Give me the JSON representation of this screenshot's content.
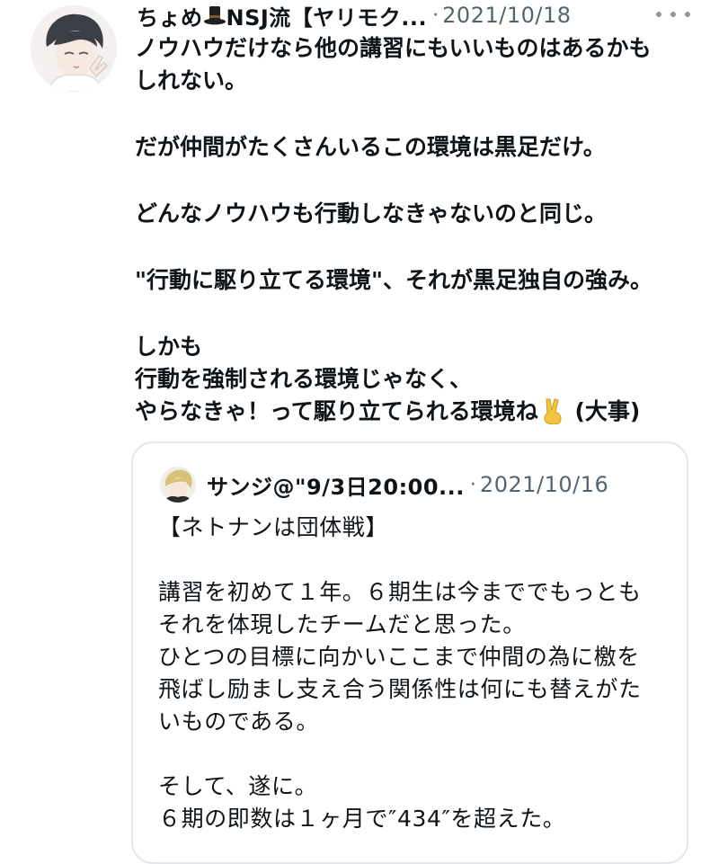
{
  "tweet": {
    "author": {
      "display_name": "ちょめ",
      "name_suffix": "NSJ流【ヤリモク...",
      "avatar_icon": "avatar-illustration"
    },
    "date": "2021/10/18",
    "separator": "·",
    "more_icon": "more-horizontal-icon",
    "lines": [
      "ノウハウだけなら他の講習にもいいものはあるかも",
      "しれない。",
      "",
      "だが仲間がたくさんいるこの環境は黒足だけ。",
      "",
      "どんなノウハウも行動しなきゃないのと同じ。",
      "",
      "\"行動に駆り立てる環境\"、それが黒足独自の強み。",
      "",
      "しかも",
      "行動を強制される環境じゃなく、"
    ],
    "last_line_before_emoji": "やらなきゃ！って駆り立てられる環境ね",
    "last_line_after_emoji": " (大事)"
  },
  "quote": {
    "author": {
      "display_name": "サンジ@\"9/3日20:00...",
      "avatar_icon": "avatar-illustration"
    },
    "separator": "·",
    "date": "2021/10/16",
    "lines": [
      "【ネトナンは団体戦】",
      "",
      "講習を初めて１年。６期生は今まででもっとも",
      "それを体現したチームだと思った。",
      "ひとつの目標に向かいここまで仲間の為に檄を",
      "飛ばし励まし支え合う関係性は何にも替えがた",
      "いものである。",
      "",
      "そして、遂に。",
      "６期の即数は１ヶ月で″434″を超えた。"
    ]
  },
  "colors": {
    "text": "#0f1419",
    "secondary": "#536471",
    "border": "#e3e7ea"
  }
}
